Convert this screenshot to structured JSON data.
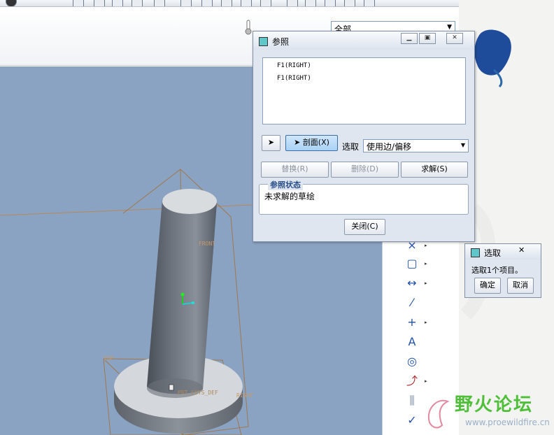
{
  "filter": {
    "value": "全部"
  },
  "viewport": {
    "labels": {
      "front": "FRONT",
      "top": "TOP",
      "right": "RIGHT",
      "csys": "PRT_CSYS_DEF"
    }
  },
  "ref_dialog": {
    "title": "参照",
    "items": [
      "F1(RIGHT)",
      "F1(RIGHT)"
    ],
    "section_button": "剖面(X)",
    "select_label": "选取",
    "select_value": "使用边/偏移",
    "replace_button": "替换(R)",
    "delete_button": "删除(D)",
    "solve_button": "求解(S)",
    "status_legend": "参照状态",
    "status_text": "未求解的草绘",
    "close_button": "关闭(C)"
  },
  "select_dialog": {
    "title": "选取",
    "message": "选取1个项目。",
    "ok_button": "确定",
    "cancel_button": "取消"
  },
  "watermark": {
    "text": "野火论坛",
    "url": "www.proewildfire.cn"
  },
  "colors": {
    "viewport_bg": "#8aa3c3",
    "accent_blue": "#1f4fa8",
    "watermark_green": "#4fbf3a"
  }
}
